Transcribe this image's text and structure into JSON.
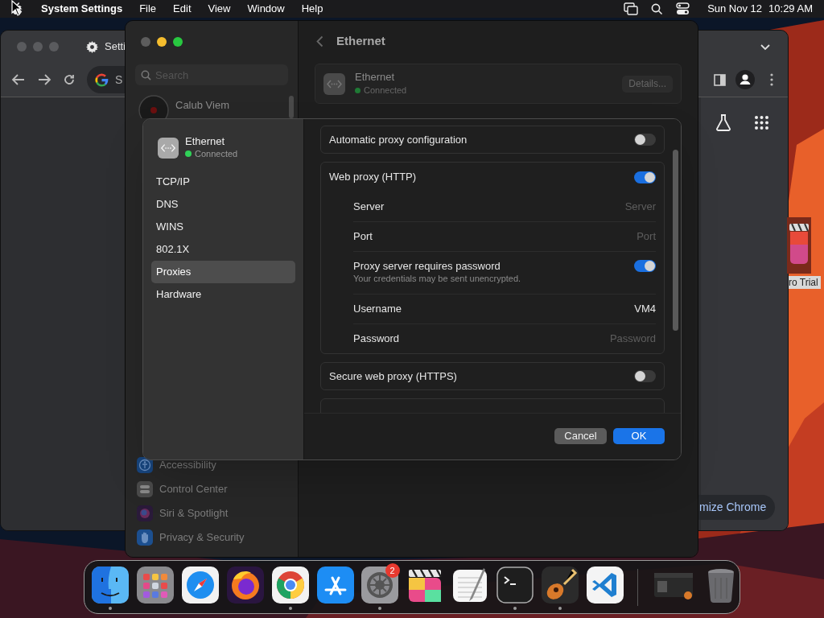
{
  "menu_bar": {
    "app": "System Settings",
    "menus": [
      "File",
      "Edit",
      "View",
      "Window",
      "Help"
    ],
    "date": "Sun Nov 12",
    "time": "10:29 AM"
  },
  "browser_window": {
    "tab_title": "Setti",
    "address_text": "S",
    "customize_button": "mize Chrome"
  },
  "desktop_icon": {
    "label": "ro Trial"
  },
  "settings_window": {
    "search": {
      "placeholder": "Search"
    },
    "account": {
      "name": "Calub Viem"
    },
    "sidebar": {
      "items": [
        {
          "label": "Accessibility"
        },
        {
          "label": "Control Center"
        },
        {
          "label": "Siri & Spotlight"
        },
        {
          "label": "Privacy & Security"
        }
      ]
    },
    "title": "Ethernet",
    "interface": {
      "name": "Ethernet",
      "status": "Connected",
      "connected": true,
      "button": "Details..."
    }
  },
  "sheet": {
    "interface": {
      "name": "Ethernet",
      "status": "Connected",
      "connected": true
    },
    "tabs": [
      {
        "label": "TCP/IP",
        "selected": false
      },
      {
        "label": "DNS",
        "selected": false
      },
      {
        "label": "WINS",
        "selected": false
      },
      {
        "label": "802.1X",
        "selected": false
      },
      {
        "label": "Proxies",
        "selected": true
      },
      {
        "label": "Hardware",
        "selected": false
      }
    ],
    "groups": [
      {
        "label": "Automatic proxy configuration",
        "on": false
      },
      {
        "label": "Web proxy (HTTP)",
        "on": true,
        "rows": [
          {
            "kind": "field",
            "label": "Server",
            "placeholder": "Server"
          },
          {
            "kind": "field",
            "label": "Port",
            "placeholder": "Port"
          },
          {
            "kind": "toggle",
            "label": "Proxy server requires password",
            "note": "Your credentials may be sent unencrypted.",
            "on": true
          },
          {
            "kind": "field",
            "label": "Username",
            "value": "VM4"
          },
          {
            "kind": "field",
            "label": "Password",
            "placeholder": "Password"
          }
        ]
      },
      {
        "label": "Secure web proxy (HTTPS)",
        "on": false
      }
    ],
    "buttons": [
      {
        "label": "Cancel",
        "kind": "secondary"
      },
      {
        "label": "OK",
        "kind": "primary"
      }
    ]
  },
  "dock": {
    "apps": [
      {
        "kind": "finder",
        "running": true
      },
      {
        "kind": "launchpad",
        "running": false
      },
      {
        "kind": "safari",
        "running": false
      },
      {
        "kind": "firefox",
        "running": false
      },
      {
        "kind": "chrome",
        "running": true
      },
      {
        "kind": "appstore",
        "running": false
      },
      {
        "kind": "settings",
        "running": true,
        "badge": "2"
      },
      {
        "kind": "finalcut",
        "running": false
      },
      {
        "kind": "textedit",
        "running": false
      },
      {
        "kind": "terminal",
        "running": true
      },
      {
        "kind": "garageband",
        "running": true
      },
      {
        "kind": "vscode",
        "running": false
      }
    ],
    "others": [
      {
        "kind": "window"
      },
      {
        "kind": "trash"
      }
    ]
  }
}
